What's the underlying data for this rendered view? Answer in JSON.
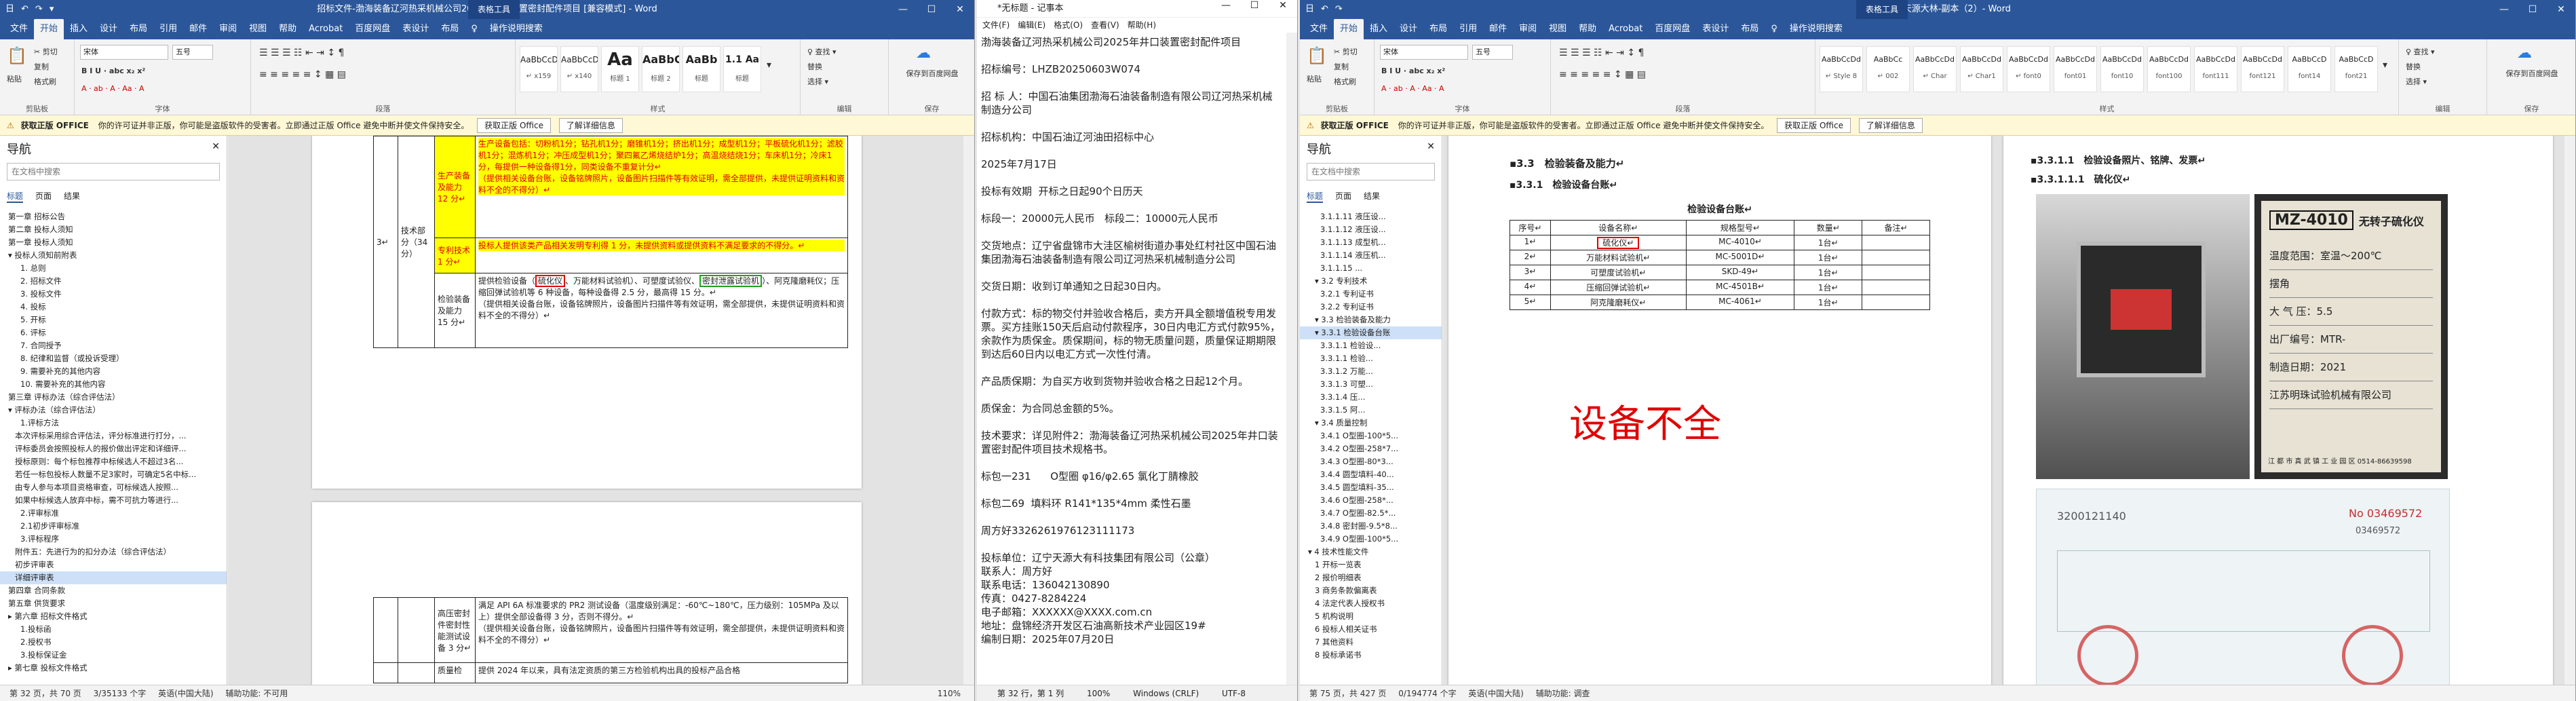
{
  "w1": {
    "title": "招标文件-渤海装备辽河热采机械公司2025年井口装置密封配件项目 [兼容模式] - Word",
    "context_tab": "表格工具",
    "qa": [
      "日",
      "↶",
      "↷",
      "▾"
    ],
    "tabs": [
      "文件",
      "开始",
      "插入",
      "设计",
      "布局",
      "引用",
      "邮件",
      "审阅",
      "视图",
      "帮助",
      "Acrobat",
      "百度网盘",
      "表设计",
      "布局",
      "♀",
      "操作说明搜索"
    ],
    "clipboard": {
      "paste": "粘贴",
      "cut": "✂ 剪切",
      "copy": "复制",
      "painter": "格式刷",
      "label": "剪贴板"
    },
    "font": {
      "name": "宋体",
      "size": "五号",
      "label": "字体",
      "row2": "B I U · abc x₂ x²",
      "row3": "A · ab · A · Aa · A"
    },
    "para": {
      "label": "段落",
      "row1": "☰ ☰ ☰ ☷ ⇤ ⇥ ↕ ¶",
      "row2": "≡ ≡ ≡ ≡ ≡ ↕ ▦ ▤"
    },
    "styles": {
      "label": "样式",
      "items": [
        {
          "big": "AaBbCcDd",
          "name": "↵ x159"
        },
        {
          "big": "AaBbCcDd",
          "name": "↵ x140"
        },
        {
          "big": "Aa",
          "name": "标题 1"
        },
        {
          "big": "AaBbC",
          "name": "标题 2"
        },
        {
          "big": "AaBb",
          "name": "标题"
        },
        {
          "big": "1.1 Aa",
          "name": "标题"
        }
      ]
    },
    "edit": {
      "find": "♀ 查找 ▾",
      "replace": "替换",
      "select": "选择 ▾",
      "label": "编辑"
    },
    "save": {
      "label": "保存到百度网盘",
      "sub": "保存"
    },
    "msg": {
      "icon": "⚠",
      "lead": "获取正版 OFFICE",
      "text": "你的许可证并非正版，你可能是盗版软件的受害者。立即通过正版 Office 避免中断并使文件保持安全。",
      "btn1": "获取正版 Office",
      "btn2": "了解详细信息"
    },
    "nav": {
      "title": "导航",
      "close": "✕",
      "search": "在文档中搜索",
      "tabs": [
        "标题",
        "页面",
        "结果"
      ],
      "items": [
        "第一章 招标公告",
        "第二章 投标人须知",
        "第一章 投标人须知",
        "▾ 投标人须知前附表",
        "1. 总则",
        "2. 招标文件",
        "3. 投标文件",
        "4. 投标",
        "5. 开标",
        "6. 评标",
        "7. 合同授予",
        "8. 纪律和监督（或投诉受理）",
        "9. 需要补充的其他内容",
        "10. 需要补充的其他内容",
        "第三章 评标办法（综合评估法）",
        "▾ 评标办法（综合评估法）",
        "1.评标方法",
        "本次评标采用综合评估法，评分标准进行打分，...",
        "评标委员会按照投标人的报价做出评定和详细评...",
        "授标原则：每个标包推荐中标候选人不超过3名...",
        "若任一标包投标人数量不足3家时，可确定5名中标...",
        "由专人参与本项目资格审查，可标候选人按照...",
        "如果中标候选人放弃中标，需不可抗力等进行...",
        "2.评审标准",
        "2.1初步评审标准",
        "3.评标程序",
        "附件五：先进行为的扣分办法（综合评估法）",
        "初步评审表",
        "详细评审表",
        "第四章 合同条款",
        "第五章 供货要求",
        "▸ 第六章 招标文件格式",
        "1.投标函",
        "2.授权书",
        "3.投标保证金",
        "▸ 第七章 投标文件格式"
      ],
      "selected": 28
    },
    "doc": {
      "r1_label": "生产装备及能力 12 分↵",
      "r1_text": "生产设备包括：切粉机1分；钻孔机1分；磨锥机1分；挤出机1分；成型机1分；平板硫化机1分；滤胶机1分；混炼机1分；冲压成型机1分；聚四氟乙烯烧结炉1分；高温烧结烧1分；车床机1分；冷床1分，每提供一种设备得1分，同类设备不重复计分↵",
      "r1_note": "（提供相关设备台账，设备铭牌照片，设备图片扫描件等有效证明，需全部提供，未提供证明资料和资料不全的不得分）↵",
      "main_label": "技术部分（34 分）",
      "idx": "3↵",
      "r2_label": "专利技术 1 分↵",
      "r2_text": "投标人提供该类产品相关发明专利得 1 分，未提供资料或提供资料不满足要求的不得分。↵",
      "r3_label": "检验装备及能力 15 分↵",
      "r3_text_a": "提供检验设备（",
      "r3_box1": "硫化仪",
      "r3_text_b": "、万能材料试验机）、可塑度试验仪、",
      "r3_box2": "密封泄露试验机",
      "r3_text_c": "）、阿克隆磨耗仪；压缩回弹试验机等 6 种设备，每种设备得 2.5 分，最高得 15 分。↵",
      "r3_note": "（提供相关设备台账，设备铭牌照片，设备图片扫描件等有效证明，需全部提供，未提供证明资料和资料不全的不得分）↵",
      "r4_label": "高压密封件密封性能测试设备 3 分↵",
      "r4_text": "满足 API 6A 标准要求的 PR2 测试设备（温度级别满足：-60℃~180℃，压力级别：105MPa 及以上）提供全部设备得 3 分，否则不得分。↵",
      "r4_note": "（提供相关设备台账，设备铭牌照片，设备图片扫描件等有效证明，需全部提供，未提供证明资料和资料不全的不得分）↵",
      "r5_label": "质量检",
      "r5_text": "提供 2024 年以来，具有法定资质的第三方检验机构出具的投标产品合格"
    },
    "status": [
      "第 32 页，共 70 页",
      "3/35133 个字",
      "英语(中国大陆)",
      "辅助功能: 不可用",
      "110%"
    ]
  },
  "w2": {
    "title": "*无标题 - 记事本",
    "menu": [
      "文件(F)",
      "编辑(E)",
      "格式(O)",
      "查看(V)",
      "帮助(H)"
    ],
    "lines": [
      "渤海装备辽河热采机械公司2025年井口装置密封配件项目",
      "招标编号：LHZB20250603W074",
      "招 标 人：中国石油集团渤海石油装备制造有限公司辽河热采机械制造分公司",
      "招标机构：中国石油辽河油田招标中心",
      "2025年7月17日",
      "投标有效期  开标之日起90个日历天",
      "标段一：20000元人民币   标段二：10000元人民币",
      "交货地点：辽宁省盘锦市大洼区榆树街道办事处红村社区中国石油集团渤海石油装备制造有限公司辽河热采机械制造分公司",
      "交货日期：收到订单通知之日起30日内。",
      "付款方式：标的物交付并验收合格后，卖方开具全额增值税专用发票。买方挂账150天后启动付款程序，30日内电汇方式付款95%，余款作为质保金。质保期间，标的物无质量问题，质量保证期期限到达后60日内以电汇方式一次性付清。",
      "产品质保期：为自买方收到货物并验收合格之日起12个月。",
      "质保金：为合同总金额的5%。",
      "技术要求：详见附件2：渤海装备辽河热采机械公司2025年井口装置密封配件项目技术规格书。",
      "标包一231      O型圈 φ16/φ2.65 氯化丁腈橡胶",
      "标包二69  填料环 R141*135*4mm 柔性石墨",
      "周方好3326261976123111173",
      "投标单位：辽宁天源大有科技集团有限公司（公章）\n联系人：周方好\n联系电话：136042130890\n传真：0427-8284224\n电子邮箱：XXXXXX@XXXX.com.cn\n地址：盘锦经济开发区石油高新技术产业园区19#\n编制日期：2025年07月20日"
    ],
    "status": [
      "第 32 行，第 1 列",
      "100%",
      "Windows (CRLF)",
      "UTF-8"
    ]
  },
  "w3": {
    "title": "投标文件-天源大林-副本（2）- Word",
    "context_tab": "表格工具",
    "tabs": [
      "文件",
      "开始",
      "插入",
      "设计",
      "布局",
      "引用",
      "邮件",
      "审阅",
      "视图",
      "帮助",
      "Acrobat",
      "百度网盘",
      "表设计",
      "布局",
      "♀",
      "操作说明搜索"
    ],
    "font": {
      "name": "宋体",
      "size": "五号"
    },
    "styles": [
      {
        "big": "AaBbCcDd",
        "name": "↵ Style 8"
      },
      {
        "big": "AaBbCc",
        "name": "↵ 002"
      },
      {
        "big": "AaBbCcDd",
        "name": "↵ Char"
      },
      {
        "big": "AaBbCcDd",
        "name": "↵ Char1"
      },
      {
        "big": "AaBbCcDd",
        "name": "↵ font0"
      },
      {
        "big": "AaBbCcDd",
        "name": "font01"
      },
      {
        "big": "AaBbCcDd",
        "name": "font10"
      },
      {
        "big": "AaBbCcDd",
        "name": "font100"
      },
      {
        "big": "AaBbCcDd",
        "name": "font111"
      },
      {
        "big": "AaBbCcDd",
        "name": "font121"
      },
      {
        "big": "AaBbCcD",
        "name": "font14"
      },
      {
        "big": "AaBbCcD",
        "name": "font21"
      }
    ],
    "msg": {
      "icon": "⚠",
      "lead": "获取正版 OFFICE",
      "text": "你的许可证并非正版，你可能是盗版软件的受害者。立即通过正版 Office 避免中断并使文件保持安全。",
      "btn1": "获取正版 Office",
      "btn2": "了解详细信息"
    },
    "nav": {
      "title": "导航",
      "close": "✕",
      "search": "在文档中搜索",
      "tabs": [
        "标题",
        "页面",
        "结果"
      ],
      "items": [
        "3.1.1.11 液压设...",
        "3.1.1.12 液压设...",
        "3.1.1.13 成型机...",
        "3.1.1.14 液压机...",
        "3.1.1.15 ...",
        "▾ 3.2 专利技术",
        "3.2.1 专利证书",
        "3.2.2 专利证书",
        "▾ 3.3 检验装备及能力",
        "▾ 3.3.1 检验设备台账",
        "3.3.1.1 检验设...",
        "3.3.1.1 检验...",
        "3.3.1.2 万能...",
        "3.3.1.3 可塑...",
        "3.3.1.4 压...",
        "3.3.1.5 阿...",
        "▾ 3.4 质量控制",
        "3.4.1 O型圈-100*5...",
        "3.4.2 O型圈-258*7...",
        "3.4.3 O型圈-80*3...",
        "3.4.4 圆型填料-40...",
        "3.4.5 圆型填料-35...",
        "3.4.6 O型圈-258*...",
        "3.4.7 O型圈-82.5*...",
        "3.4.8 密封圈-9.5*8...",
        "3.4.9 O型圈-100*5...",
        "▾ 4 技术性能文件",
        "1 开标一览表",
        "2 报价明细表",
        "3 商务条款偏离表",
        "4 法定代表人授权书",
        "5 机构说明",
        "6 投标人相关证书",
        "7 其他资料",
        "8 投标承诺书"
      ],
      "selected": 9
    },
    "doc": {
      "h33": "▪3.3　检验装备及能力↵",
      "h331": "▪3.3.1　检验设备台账↵",
      "tbl_title": "检验设备台账↵",
      "cols": [
        "序号↵",
        "设备名称↵",
        "规格型号↵",
        "数量↵",
        "备注↵"
      ],
      "rows": [
        [
          "1↵",
          "硫化仪↵",
          "MC-4010↵",
          "1台↵",
          ""
        ],
        [
          "2↵",
          "万能材料试验机↵",
          "MC-5001D↵",
          "1台↵",
          ""
        ],
        [
          "3↵",
          "可塑度试验机↵",
          "SKD-49↵",
          "1台↵",
          ""
        ],
        [
          "4↵",
          "压缩回弹试验机↵",
          "MC-4501B↵",
          "1台↵",
          ""
        ],
        [
          "5↵",
          "阿克隆磨耗仪↵",
          "MC-4061↵",
          "1台↵",
          ""
        ]
      ],
      "comment": "设备不全",
      "h3311": "▪3.3.1.1　检验设备照片、铭牌、发票↵",
      "h33111": "▪3.3.1.1.1　硫化仪↵",
      "plate_model": "MZ-4010",
      "plate_head": "无转子硫化仪",
      "plate_lines": [
        "温度范围：室温～200℃",
        "摆角",
        "大 气 压：5.5",
        "出厂编号：MTR-",
        "制造日期：2021",
        "江苏明珠试验机械有限公司"
      ],
      "plate_foot": "江 都 市 真 武 镇 工 业 园 区   0514-86639598",
      "invoice_no": "3200121140",
      "invoice_id": "No 03469572",
      "invoice_id2": "03469572"
    },
    "status": [
      "第 75 页，共 427 页",
      "0/194774 个字",
      "英语(中国大陆)",
      "辅助功能: 调查"
    ]
  }
}
